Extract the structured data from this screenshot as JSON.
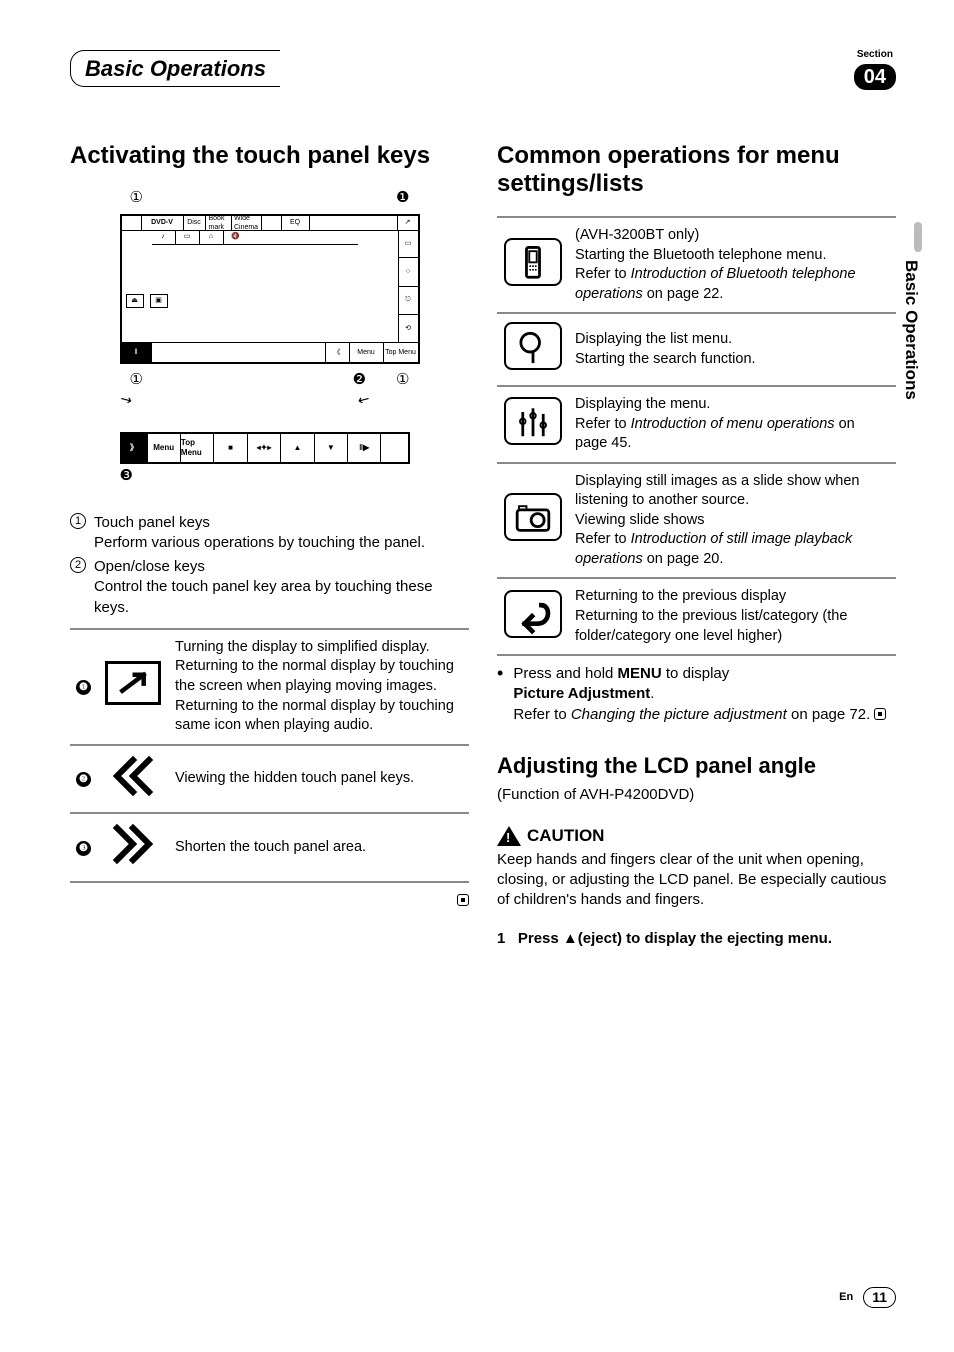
{
  "section_label": "Section",
  "section_number": "04",
  "chapter_title": "Basic Operations",
  "side_tab": "Basic Operations",
  "footer": {
    "lang": "En",
    "page": "11"
  },
  "left": {
    "h2": "Activating the touch panel keys",
    "callouts": {
      "top_left": "①",
      "top_right": "❶",
      "bot_left": "①",
      "bot_mid": "❷",
      "bot_right": "①",
      "popup_marker": "❸"
    },
    "screen": {
      "row1": [
        "",
        "DVD-V",
        "Disc",
        "Book mark",
        "Wide Cinema",
        "",
        "EQ",
        "",
        "",
        ""
      ],
      "row2": [
        "♪",
        "▭",
        "⌂",
        "🔇"
      ],
      "right_col": [
        "▭",
        "○",
        "⎋",
        "⟲"
      ],
      "left_boxes": [
        "⏏",
        "▣"
      ],
      "bottom": [
        "‖",
        "",
        "",
        "",
        "《",
        "Menu",
        "Top Menu"
      ],
      "popup": [
        "》",
        "Menu",
        "Top Menu",
        "■",
        "◂✦▸",
        "▲",
        "▼",
        "‖▶",
        ""
      ]
    },
    "numbered": [
      {
        "num": "①",
        "title": "Touch panel keys",
        "desc": "Perform various operations by touching the panel."
      },
      {
        "num": "②",
        "title": "Open/close keys",
        "desc": "Control the touch panel key area by touching these keys."
      }
    ],
    "icons": [
      {
        "mark": "❶",
        "glyph": "expand",
        "desc": "Turning the display to simplified display.\nReturning to the normal display by touching the screen when playing moving images.\nReturning to the normal display by touching same icon when playing audio."
      },
      {
        "mark": "❷",
        "glyph": "chev-left",
        "desc": "Viewing the hidden touch panel keys."
      },
      {
        "mark": "❸",
        "glyph": "chev-right",
        "desc": "Shorten the touch panel area."
      }
    ]
  },
  "right": {
    "h2": "Common operations for menu settings/lists",
    "ops": [
      {
        "glyph": "phone",
        "lines": [
          "(AVH-3200BT only)",
          "Starting the Bluetooth telephone menu.",
          "Refer to ",
          "_Introduction of Bluetooth telephone operations_",
          " on page 22."
        ]
      },
      {
        "glyph": "search",
        "lines": [
          "Displaying the list menu.",
          "Starting the search function."
        ]
      },
      {
        "glyph": "sliders",
        "lines": [
          "Displaying the menu.",
          "Refer to ",
          "_Introduction of menu operations_",
          " on page 45."
        ]
      },
      {
        "glyph": "camera",
        "lines": [
          "Displaying still images as a slide show when listening to another source.",
          "Viewing slide shows",
          "Refer to ",
          "_Introduction of still image playback operations_",
          " on page 20."
        ]
      },
      {
        "glyph": "back",
        "lines": [
          "Returning to the previous display",
          "Returning to the previous list/category (the folder/category one level higher)"
        ]
      }
    ],
    "menu_note": {
      "pre": "Press and hold ",
      "bold1": "MENU",
      "mid": " to display ",
      "bold2": "Picture Adjustment",
      "after": ".",
      "refer_pre": "Refer to ",
      "refer_ital": "Changing the picture adjustment",
      "refer_post": " on page 72."
    },
    "h3": "Adjusting the LCD panel angle",
    "func_of": "(Function of AVH-P4200DVD)",
    "caution_label": "CAUTION",
    "caution_text": "Keep hands and fingers clear of the unit when opening, closing, or adjusting the LCD panel. Be especially cautious of children's hands and fingers.",
    "step1_pre": "1",
    "step1_text_a": "Press ",
    "step1_eject": "▲",
    "step1_text_b": "(eject) to display the ejecting menu."
  }
}
